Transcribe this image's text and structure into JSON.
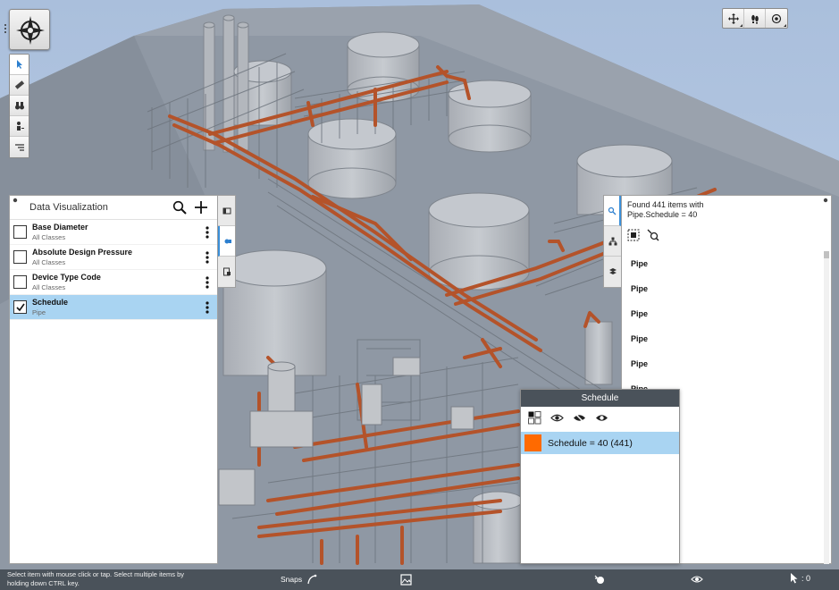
{
  "colors": {
    "pipe": "#b4532a",
    "status_bar": "#4a525a",
    "selection": "#a9d4f2",
    "schedule_swatch": "#ff6a00"
  },
  "toolbar": {
    "logo_icon": "compass-rose-icon",
    "tools": [
      "pointer-icon",
      "measure-icon",
      "binoculars-icon",
      "person-icon",
      "tree-icon"
    ],
    "nav_tools": [
      "move-icon",
      "walk-icon",
      "orbit-icon"
    ]
  },
  "data_visualization": {
    "title": "Data Visualization",
    "items": [
      {
        "name": "Base Diameter",
        "sub": "All Classes",
        "checked": false
      },
      {
        "name": "Absolute Design Pressure",
        "sub": "All Classes",
        "checked": false
      },
      {
        "name": "Device Type Code",
        "sub": "All Classes",
        "checked": false
      },
      {
        "name": "Schedule",
        "sub": "Pipe",
        "checked": true
      }
    ],
    "side_tabs": [
      "panel-collapse-icon",
      "data-viz-icon",
      "report-icon"
    ]
  },
  "results": {
    "line1": "Found 441 items with",
    "line2": "Pipe.Schedule = 40",
    "side_tabs": [
      "search-results-icon",
      "hierarchy-icon",
      "layers-icon"
    ],
    "items": [
      "Pipe",
      "Pipe",
      "Pipe",
      "Pipe",
      "Pipe",
      "Pipe"
    ]
  },
  "schedule_legend": {
    "title": "Schedule",
    "row_label": "Schedule = 40 (441)"
  },
  "status": {
    "hint": "Select item with mouse click or tap. Select multiple items by holding down CTRL key.",
    "snaps_label": "Snaps",
    "selected_count": ": 0"
  }
}
